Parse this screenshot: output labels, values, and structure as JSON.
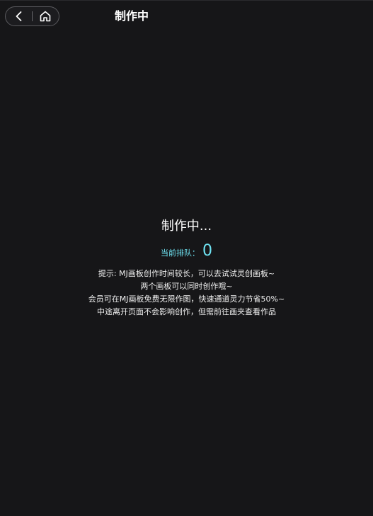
{
  "header": {
    "title": "制作中",
    "back_icon": "chevron-left-icon",
    "home_icon": "home-icon"
  },
  "status": {
    "title": "制作中...",
    "queue_label": "当前排队：",
    "queue_count": "0"
  },
  "tips": [
    "提示: MJ画板创作时间较长，可以去试试灵创画板~",
    "两个画板可以同时创作哦~",
    "会员可在MJ画板免费无限作图，快速通道灵力节省50%~",
    "中途离开页面不会影响创作，但需前往画夹查看作品"
  ],
  "colors": {
    "background": "#161618",
    "accent": "#6fe3f2",
    "text": "#ffffff"
  }
}
